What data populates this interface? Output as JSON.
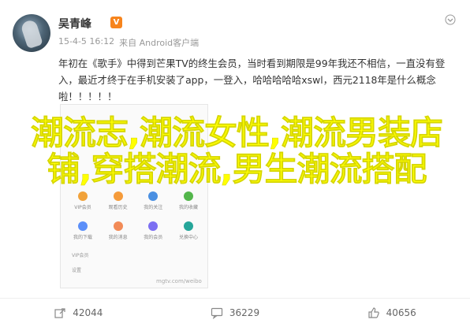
{
  "post": {
    "username": "吴青峰",
    "vip_badge": "V",
    "time": "15-4-5 16:12",
    "source": "来自 Android客户端",
    "content": "年初在《歌手》中得到芒果TV的终生会员，当时看到期限是99年我还不相信，一直没有登入，最近才终于在手机安装了app，一登入，哈哈哈哈哈xswl，西元2118年是什么概念啦！！！！！",
    "overlay_text": "潮流志,潮流女性,潮流男装店铺,穿搭潮流,男生潮流搭配",
    "watermark": "mgtv.com/weibo",
    "thumbnail": {
      "rows": [
        [
          {
            "label": "VIP会员",
            "color": "#f1a23a"
          },
          {
            "label": "观看历史",
            "color": "#f59b3a"
          },
          {
            "label": "我的关注",
            "color": "#4a90e2"
          },
          {
            "label": "我的收藏",
            "color": "#53b64b"
          }
        ],
        [
          {
            "label": "我的下载",
            "color": "#5b8ff9"
          },
          {
            "label": "我的消息",
            "color": "#f28b57"
          },
          {
            "label": "我的会员",
            "color": "#7c6ff2"
          },
          {
            "label": "兑换中心",
            "color": "#26a69a"
          }
        ]
      ],
      "small1": "VIP会员",
      "small2": "设置"
    },
    "actions": {
      "share_count": "42044",
      "comment_count": "36229",
      "like_count": "40656"
    }
  }
}
